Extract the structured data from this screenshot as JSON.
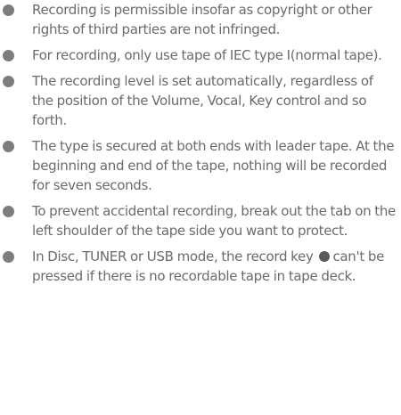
{
  "notes": [
    {
      "text": "Recording is permissible insofar as copyright or other rights of third parties are not infringed."
    },
    {
      "text": "For recording, only use tape of IEC type I(normal tape)."
    },
    {
      "text": "The recording level is set automatically, regardless of the position of the Volume, Vocal, Key control and so forth."
    },
    {
      "text": "The type is secured at both ends with leader tape. At the beginning and end of the tape, nothing will be recorded for seven seconds."
    },
    {
      "text": "To prevent accidental recording, break out the tab on the left shoulder of the tape side you want to protect."
    },
    {
      "text_before": "In Disc, TUNER or USB mode, the record key",
      "text_after": "can't be pressed if there is no recordable tape in tape deck."
    }
  ],
  "icons": {
    "bullet": "filled-circle-bullet",
    "record_key": "record-dot-icon"
  },
  "colors": {
    "text": "#6b6b6b",
    "bullet": "#7d7d7d"
  }
}
